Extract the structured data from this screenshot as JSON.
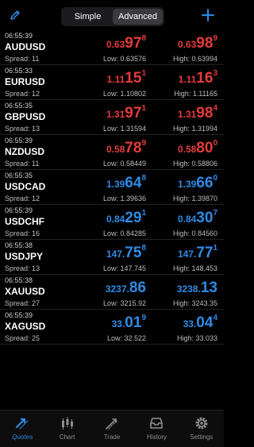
{
  "header": {
    "segments": [
      "Simple",
      "Advanced"
    ],
    "active_segment": "Advanced"
  },
  "quotes": [
    {
      "time": "06:55:39",
      "symbol": "AUDUSD",
      "spread": "Spread: 11",
      "color": "red",
      "bid": {
        "small": "0.63",
        "big": "97",
        "sup": "8"
      },
      "ask": {
        "small": "0.63",
        "big": "98",
        "sup": "9"
      },
      "low": "Low: 0.63576",
      "high": "High: 0.63994"
    },
    {
      "time": "06:55:33",
      "symbol": "EURUSD",
      "spread": "Spread: 12",
      "color": "red",
      "bid": {
        "small": "1.11",
        "big": "15",
        "sup": "1"
      },
      "ask": {
        "small": "1.11",
        "big": "16",
        "sup": "3"
      },
      "low": "Low: 1.10802",
      "high": "High: 1.11165"
    },
    {
      "time": "06:55:35",
      "symbol": "GBPUSD",
      "spread": "Spread: 13",
      "color": "red",
      "bid": {
        "small": "1.31",
        "big": "97",
        "sup": "1"
      },
      "ask": {
        "small": "1.31",
        "big": "98",
        "sup": "4"
      },
      "low": "Low: 1.31594",
      "high": "High: 1.31994"
    },
    {
      "time": "06:55:39",
      "symbol": "NZDUSD",
      "spread": "Spread: 11",
      "color": "red",
      "bid": {
        "small": "0.58",
        "big": "78",
        "sup": "9"
      },
      "ask": {
        "small": "0.58",
        "big": "80",
        "sup": "0"
      },
      "low": "Low: 0.58449",
      "high": "High: 0.58806"
    },
    {
      "time": "06:55:35",
      "symbol": "USDCAD",
      "spread": "Spread: 12",
      "color": "blue",
      "bid": {
        "small": "1.39",
        "big": "64",
        "sup": "8"
      },
      "ask": {
        "small": "1.39",
        "big": "66",
        "sup": "0"
      },
      "low": "Low: 1.39636",
      "high": "High: 1.39870"
    },
    {
      "time": "06:55:39",
      "symbol": "USDCHF",
      "spread": "Spread: 16",
      "color": "blue",
      "bid": {
        "small": "0.84",
        "big": "29",
        "sup": "1"
      },
      "ask": {
        "small": "0.84",
        "big": "30",
        "sup": "7"
      },
      "low": "Low: 0.84285",
      "high": "High: 0.84560"
    },
    {
      "time": "06:55:38",
      "symbol": "USDJPY",
      "spread": "Spread: 13",
      "color": "blue",
      "bid": {
        "small": "147.",
        "big": "75",
        "sup": "8"
      },
      "ask": {
        "small": "147.",
        "big": "77",
        "sup": "1"
      },
      "low": "Low: 147.745",
      "high": "High: 148.453"
    },
    {
      "time": "06:55:38",
      "symbol": "XAUUSD",
      "spread": "Spread: 27",
      "color": "blue",
      "bid": {
        "small": "3237.",
        "big": "86",
        "sup": ""
      },
      "ask": {
        "small": "3238.",
        "big": "13",
        "sup": ""
      },
      "low": "Low: 3215.92",
      "high": "High: 3243.35"
    },
    {
      "time": "06:55:39",
      "symbol": "XAGUSD",
      "spread": "Spread: 25",
      "color": "blue",
      "bid": {
        "small": "33.",
        "big": "01",
        "sup": "9"
      },
      "ask": {
        "small": "33.",
        "big": "04",
        "sup": "4"
      },
      "low": "Low: 32.522",
      "high": "High: 33.033"
    }
  ],
  "tabs": [
    {
      "label": "Quotes",
      "icon": "quotes-icon"
    },
    {
      "label": "Chart",
      "icon": "chart-icon"
    },
    {
      "label": "Trade",
      "icon": "trade-icon"
    },
    {
      "label": "History",
      "icon": "history-icon"
    },
    {
      "label": "Settings",
      "icon": "settings-icon"
    }
  ],
  "active_tab": "Quotes",
  "colors": {
    "accent": "#2f8be6",
    "down": "#e53b3b",
    "up": "#2f8be6",
    "background": "#000000"
  }
}
